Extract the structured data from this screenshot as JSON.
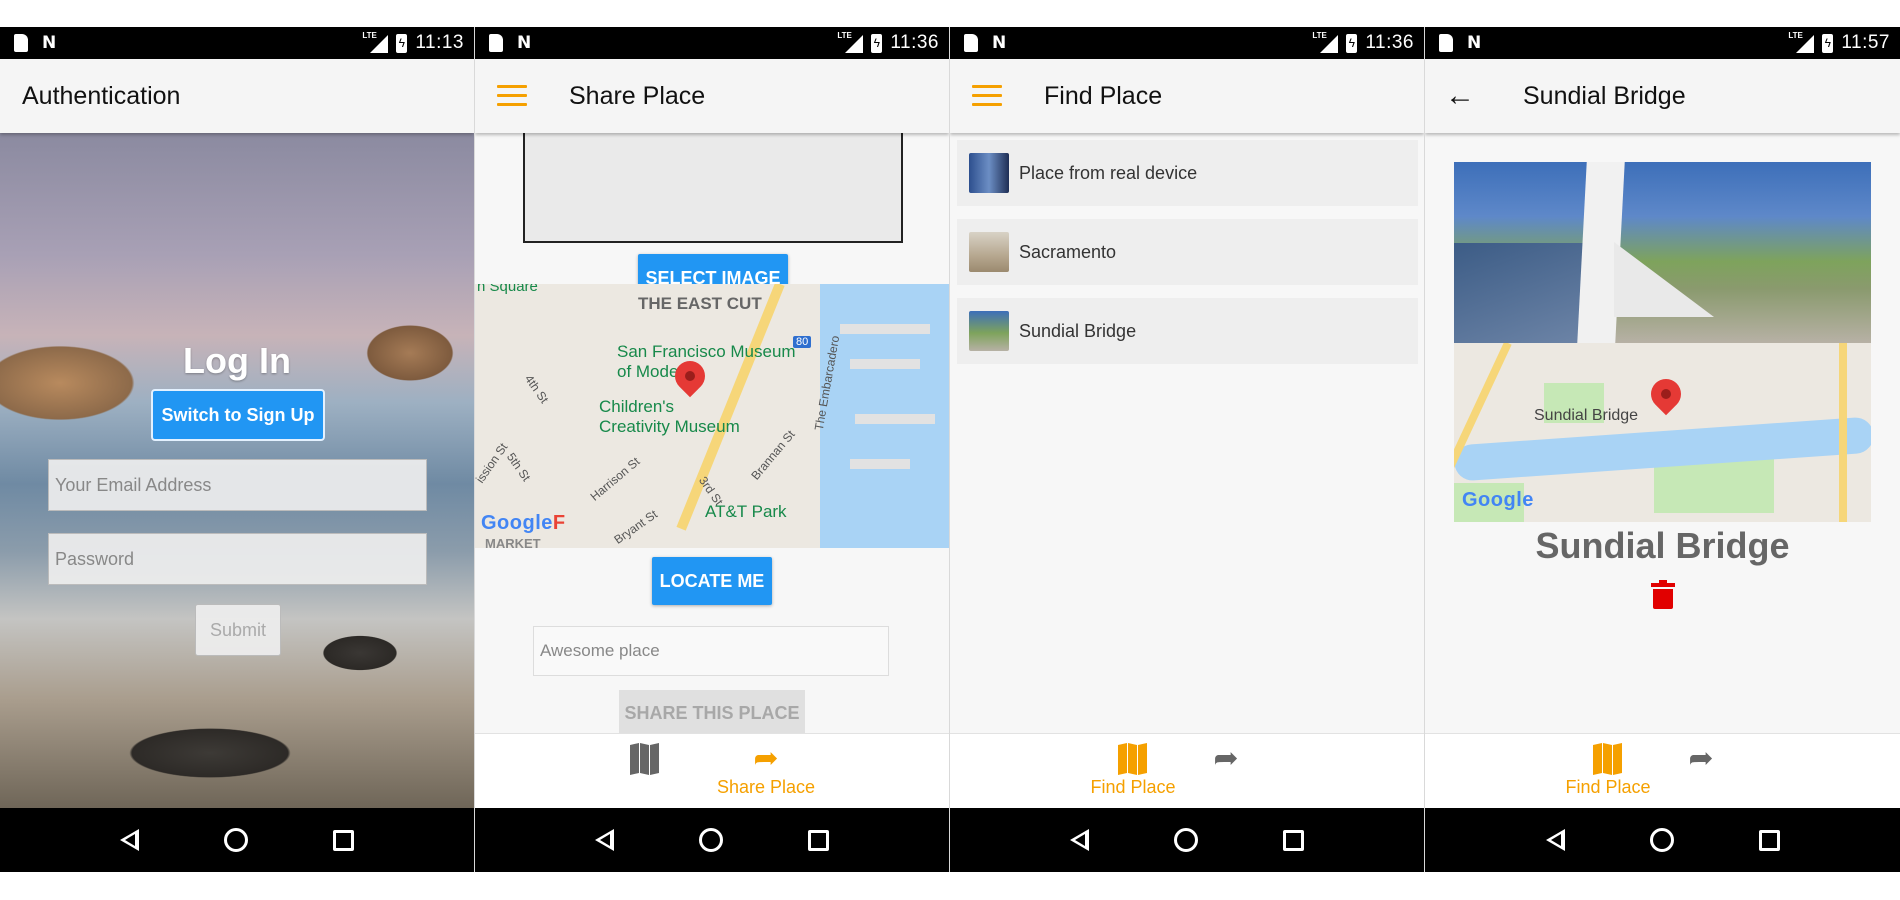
{
  "status_bars": [
    {
      "time": "11:13",
      "network": "LTE"
    },
    {
      "time": "11:36",
      "network": "LTE"
    },
    {
      "time": "11:36",
      "network": "LTE"
    },
    {
      "time": "11:57",
      "network": "LTE"
    }
  ],
  "screen_auth": {
    "appbar_title": "Authentication",
    "heading": "Log In",
    "switch_button": "Switch to Sign Up",
    "email_placeholder": "Your Email Address",
    "password_placeholder": "Password",
    "submit_button": "Submit"
  },
  "screen_share": {
    "appbar_title": "Share Place",
    "select_image_button": "SELECT IMAGE",
    "map": {
      "labels": {
        "square": "n Square",
        "east_cut": "THE EAST CUT",
        "sfmoma_line1": "San Francisco Museum",
        "sfmoma_line2": "of Modern",
        "childrens_line1": "Children's",
        "childrens_line2": "Creativity Museum",
        "fourth_st": "4th St",
        "fifth_st": "5th St",
        "mission_st": "ission St",
        "harrison_st": "Harrison St",
        "bryant_st": "Bryant St",
        "third_st": "3rd St",
        "brannan_st": "Brannan St",
        "embarcadero": "The Embarcadero",
        "att_park": "AT&T Park",
        "market": "MARKET",
        "highway": "80"
      },
      "google_logo": "Google",
      "logo_suffix": "F"
    },
    "locate_button": "LOCATE ME",
    "place_placeholder": "Awesome place",
    "share_button": "SHARE THIS PLACE",
    "tab_share_label": "Share Place"
  },
  "screen_find": {
    "appbar_title": "Find Place",
    "places": [
      {
        "name": "Place from real device"
      },
      {
        "name": "Sacramento"
      },
      {
        "name": "Sundial Bridge"
      }
    ],
    "tab_find_label": "Find Place"
  },
  "screen_detail": {
    "appbar_title": "Sundial Bridge",
    "map_label": "Sundial Bridge",
    "google_logo": "Google",
    "place_title": "Sundial Bridge",
    "tab_find_label": "Find Place"
  },
  "colors": {
    "accent": "#f5a000",
    "primary_button": "#2196f3",
    "delete": "#e10000",
    "pin": "#e53935"
  },
  "icons": {
    "menu": "menu-icon",
    "back": "arrow-back-icon",
    "map_tab": "map-icon",
    "share_tab": "share-arrow-icon",
    "delete": "trash-icon"
  }
}
